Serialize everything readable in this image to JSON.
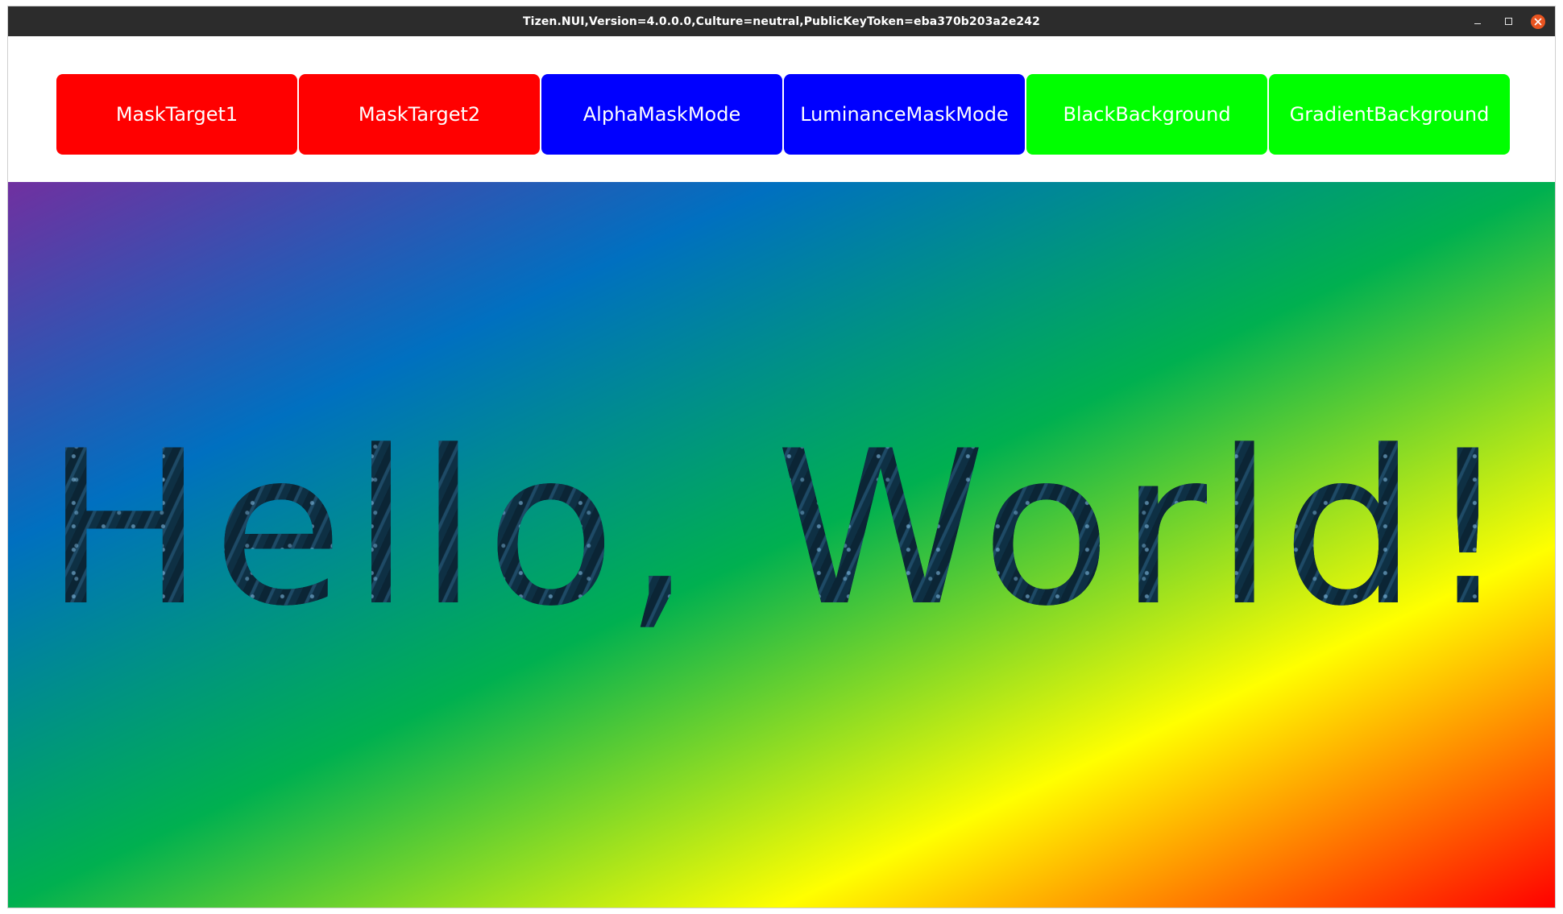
{
  "window": {
    "title": "Tizen.NUI,Version=4.0.0.0,Culture=neutral,PublicKeyToken=eba370b203a2e242"
  },
  "controls": {
    "minimize_icon": "minimize-icon",
    "maximize_icon": "maximize-icon",
    "close_icon": "close-icon",
    "close_color": "#e95420"
  },
  "toolbar": {
    "buttons": [
      {
        "label": "MaskTarget1",
        "color": "#ff0000"
      },
      {
        "label": "MaskTarget2",
        "color": "#ff0000"
      },
      {
        "label": "AlphaMaskMode",
        "color": "#0000ff"
      },
      {
        "label": "LuminanceMaskMode",
        "color": "#0000ff"
      },
      {
        "label": "BlackBackground",
        "color": "#00ff00"
      },
      {
        "label": "GradientBackground",
        "color": "#00ff00"
      }
    ]
  },
  "stage": {
    "text": "Hello, World!",
    "gradient_colors": [
      "#7030a0",
      "#0070c0",
      "#00b050",
      "#ffff00",
      "#ff0000"
    ]
  }
}
